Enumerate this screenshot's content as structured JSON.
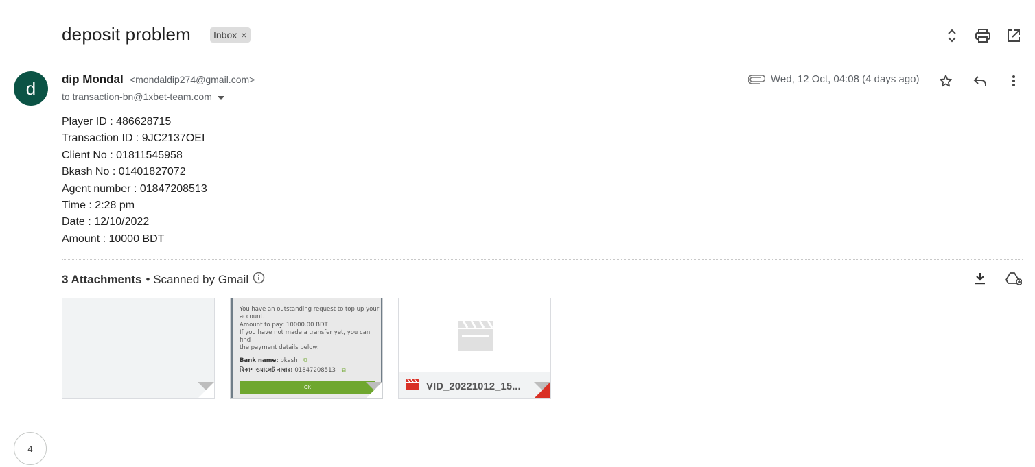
{
  "subject": "deposit problem",
  "label": {
    "text": "Inbox",
    "remove": "×"
  },
  "sender": {
    "initial": "d",
    "name": "dip Mondal",
    "email": "<mondaldip274@gmail.com>",
    "to": "to transaction-bn@1xbet-team.com",
    "date": "Wed, 12 Oct, 04:08 (4 days ago)"
  },
  "body_lines": [
    "Player ID : 486628715",
    "Transaction ID : 9JC2137OEI",
    "Client No : 01811545958",
    "Bkash No : 01401827072",
    "Agent number : 01847208513",
    "Time : 2:28 pm",
    "Date : 12/10/2022",
    "Amount : 10000 BDT"
  ],
  "attachments": {
    "count_label": "3 Attachments",
    "scanned_label": "• Scanned by Gmail",
    "preview": {
      "lines": [
        "You have an outstanding request to top up your",
        "account.",
        "Amount to pay: 10000.00 BDT",
        "If you have not made a transfer yet, you can find",
        "the payment details below:"
      ],
      "bank_label": "Bank name:",
      "bank_value": "bkash",
      "wallet_label": "বিকাশ ওয়ালেট নাম্বার:",
      "wallet_value": "01847208513",
      "ok_label": "OK"
    },
    "video_name": "VID_20221012_15..."
  },
  "thread_count": "4",
  "colors": {
    "avatar": "#0b5345",
    "ok_button": "#6fa72f",
    "video_icon": "#d93025"
  }
}
